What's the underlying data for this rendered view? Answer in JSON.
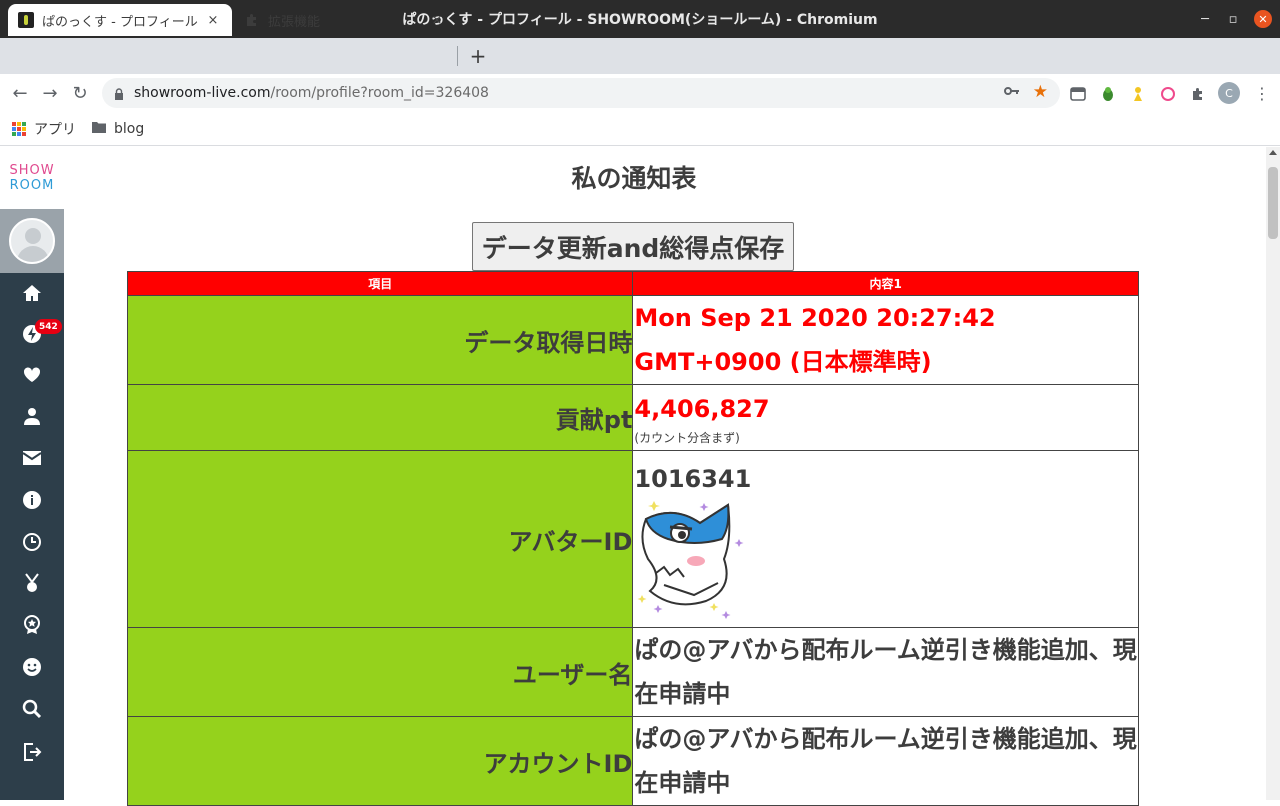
{
  "window": {
    "title": "ぱのっくす - プロフィール - SHOWROOM(ショールーム) - Chromium"
  },
  "tabs": [
    {
      "label": "ぱのっくす - プロフィール",
      "close": "×"
    },
    {
      "label": "拡張機能",
      "close": "×"
    }
  ],
  "new_tab": "+",
  "address": {
    "host": "showroom-live.com",
    "path": "/room/profile?room_id=326408"
  },
  "profile_initial": "C",
  "bookmarks": [
    {
      "label": "アプリ",
      "icon": "apps-grid-icon"
    },
    {
      "label": "blog",
      "icon": "folder-icon"
    }
  ],
  "sidebar": {
    "logo_line1": "SHOW",
    "logo_line2": "ROOM",
    "notification_count": "542",
    "icons": [
      "home-icon",
      "bolt-icon",
      "heart-icon",
      "person-icon",
      "mail-icon",
      "info-icon",
      "clock-icon",
      "medal-icon",
      "ribbon-icon",
      "smile-icon",
      "search-icon",
      "logout-icon"
    ]
  },
  "main": {
    "page_title": "私の通知表",
    "save_button": "データ更新and総得点保存",
    "table": {
      "headers": [
        "項目",
        "内容1"
      ],
      "rows": [
        {
          "key": "データ取得日時",
          "value": "Mon Sep 21 2020 20:27:42 GMT+0900 (日本標準時)"
        },
        {
          "key": "貢献pt",
          "value": "4,406,827",
          "note": "(カウント分含まず)"
        },
        {
          "key": "アバターID",
          "value": "1016341"
        },
        {
          "key": "ユーザー名",
          "value": "ぱの@アバから配布ルーム逆引き機能追加、現在申請中"
        },
        {
          "key": "アカウントID",
          "value": "ぱの@アバから配布ルーム逆引き機能追加、現在申請中"
        }
      ]
    }
  },
  "colors": {
    "header_red": "#ff0000",
    "key_green": "#95d21c",
    "sidebar_bg": "#2d3e4a",
    "badge_red": "#e60012"
  }
}
